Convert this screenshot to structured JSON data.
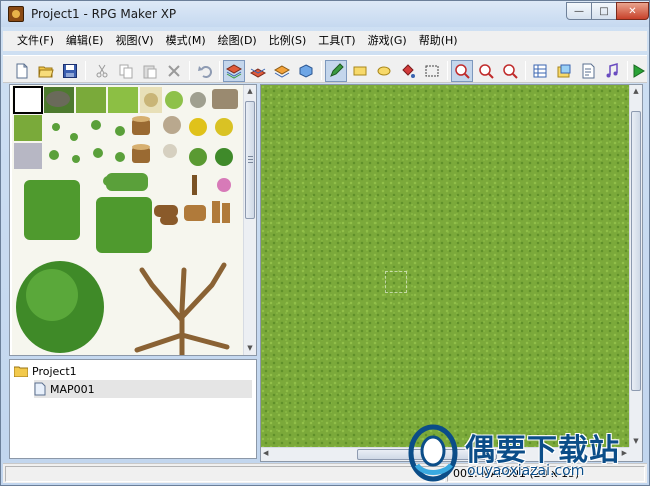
{
  "window": {
    "title": "Project1 - RPG Maker XP",
    "ghost_title": "...",
    "controls": {
      "minimize": "—",
      "maximize": "□",
      "close": "✕"
    }
  },
  "menubar": {
    "items": [
      {
        "label": "文件(F)"
      },
      {
        "label": "编辑(E)"
      },
      {
        "label": "视图(V)"
      },
      {
        "label": "模式(M)"
      },
      {
        "label": "绘图(D)"
      },
      {
        "label": "比例(S)"
      },
      {
        "label": "工具(T)"
      },
      {
        "label": "游戏(G)"
      },
      {
        "label": "帮助(H)"
      }
    ]
  },
  "toolbar": {
    "buttons": [
      {
        "icon": "new-file-icon"
      },
      {
        "icon": "open-folder-icon"
      },
      {
        "icon": "save-icon"
      },
      {
        "icon": "cut-icon"
      },
      {
        "icon": "copy-icon"
      },
      {
        "icon": "paste-icon"
      },
      {
        "icon": "delete-icon"
      },
      {
        "icon": "undo-icon"
      },
      {
        "icon": "layer-1-icon"
      },
      {
        "icon": "layer-2-icon"
      },
      {
        "icon": "layer-3-icon"
      },
      {
        "icon": "event-layer-icon"
      },
      {
        "icon": "pencil-icon"
      },
      {
        "icon": "rectangle-icon"
      },
      {
        "icon": "ellipse-icon"
      },
      {
        "icon": "fill-icon"
      },
      {
        "icon": "select-icon"
      },
      {
        "icon": "zoom-1-1-icon"
      },
      {
        "icon": "zoom-1-2-icon"
      },
      {
        "icon": "zoom-1-4-icon"
      },
      {
        "icon": "database-icon"
      },
      {
        "icon": "material-base-icon"
      },
      {
        "icon": "script-editor-icon"
      },
      {
        "icon": "sound-test-icon"
      },
      {
        "icon": "play-test-icon"
      }
    ]
  },
  "tree": {
    "root": "Project1",
    "maps": [
      {
        "label": "MAP001"
      }
    ]
  },
  "status": {
    "map_info": "001: MAP001 (20 x 15)"
  },
  "watermark": {
    "title": "偶要下载站",
    "url": "ouyaoxiazai.com"
  },
  "colors": {
    "grass": "#7ba93a",
    "accent": "#0b4d88",
    "play": "#2aa336"
  }
}
